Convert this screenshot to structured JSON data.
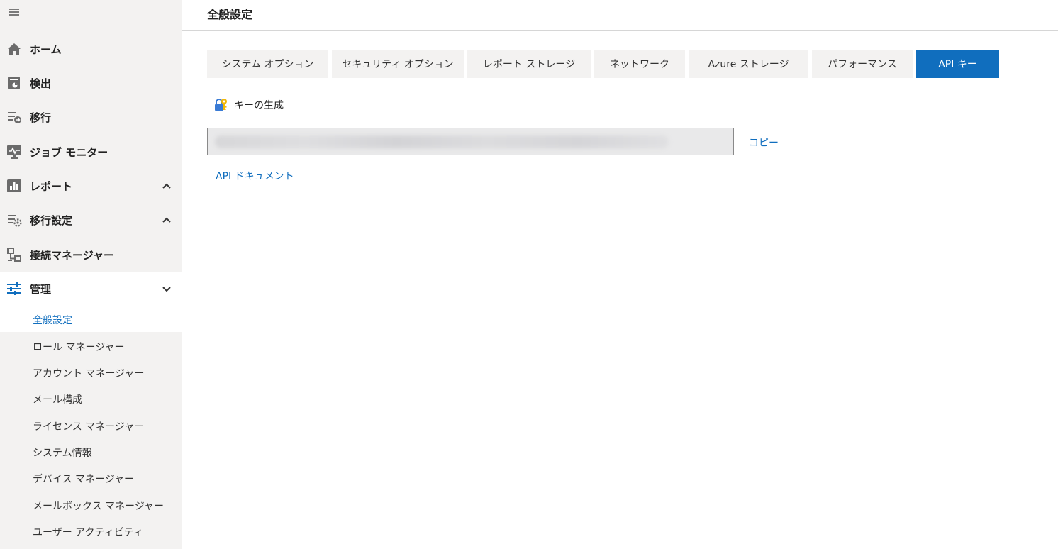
{
  "page": {
    "title": "全般設定"
  },
  "sidebar": {
    "nav": [
      {
        "label": "ホーム",
        "icon": "home-icon"
      },
      {
        "label": "検出",
        "icon": "discovery-icon"
      },
      {
        "label": "移行",
        "icon": "migration-icon"
      },
      {
        "label": "ジョブ モニター",
        "icon": "job-monitor-icon"
      },
      {
        "label": "レポート",
        "icon": "report-icon",
        "chevron": "up"
      },
      {
        "label": "移行設定",
        "icon": "migration-settings-icon",
        "chevron": "up"
      },
      {
        "label": "接続マネージャー",
        "icon": "connection-manager-icon"
      },
      {
        "label": "管理",
        "icon": "admin-icon",
        "chevron": "down",
        "expanded": true
      }
    ],
    "sub_items": [
      {
        "label": "全般設定",
        "active": true
      },
      {
        "label": "ロール マネージャー"
      },
      {
        "label": "アカウント マネージャー"
      },
      {
        "label": "メール構成"
      },
      {
        "label": "ライセンス マネージャー"
      },
      {
        "label": "システム情報"
      },
      {
        "label": "デバイス マネージャー"
      },
      {
        "label": "メールボックス マネージャー"
      },
      {
        "label": "ユーザー アクティビティ"
      }
    ]
  },
  "tabs": [
    {
      "label": "システム オプション"
    },
    {
      "label": "セキュリティ オプション"
    },
    {
      "label": "レポート ストレージ"
    },
    {
      "label": "ネットワーク"
    },
    {
      "label": "Azure ストレージ"
    },
    {
      "label": "パフォーマンス"
    },
    {
      "label": "API キー",
      "active": true
    }
  ],
  "api_key": {
    "generate_label": "キーの生成",
    "generate_icon": "key-lock-icon",
    "copy_label": "コピー",
    "docs_label": "API ドキュメント"
  },
  "colors": {
    "accent": "#106ebe",
    "sidebar_bg": "#f3f2f1",
    "tab_bg": "#f3f2f1"
  }
}
